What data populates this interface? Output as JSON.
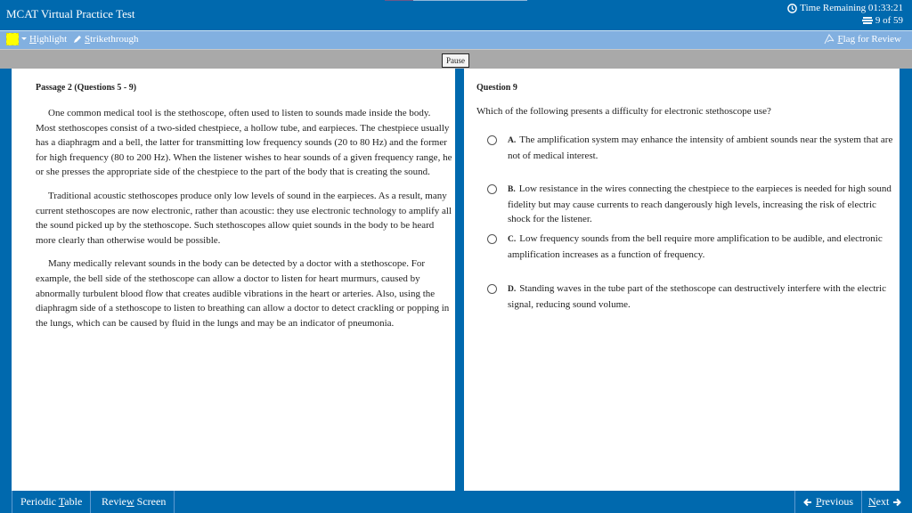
{
  "header": {
    "app_title": "MCAT Virtual Practice Test",
    "timer_label": "Time Remaining 01:33:21",
    "question_counter": "9 of 59"
  },
  "toolbar": {
    "highlight_color": "#ffff00",
    "highlight_label_u": "H",
    "highlight_label_rest": "ighlight",
    "strike_label_u": "S",
    "strike_label_rest": "trikethrough",
    "flag_label_u": "F",
    "flag_label_rest": "lag for Review"
  },
  "pause": {
    "label": "Pause"
  },
  "passage": {
    "title": "Passage 2 (Questions 5 - 9)",
    "paragraphs": [
      "One common medical tool is the stethoscope, often used to listen to sounds made inside the body. Most stethoscopes consist of a two-sided chestpiece, a hollow tube, and earpieces. The chestpiece usually has a diaphragm and a bell, the latter for transmitting low frequency sounds (20 to 80 Hz) and the former for high frequency (80 to 200 Hz). When the listener wishes to hear sounds of a given frequency range, he or she presses the appropriate side of the chestpiece to the part of the body that is creating the sound.",
      "Traditional acoustic stethoscopes produce only low levels of sound in the earpieces. As a result, many current stethoscopes are now electronic, rather than acoustic: they use electronic technology to amplify all the sound picked up by the stethoscope. Such stethoscopes allow quiet sounds in the body to be heard more clearly than otherwise would be possible.",
      "Many medically relevant sounds in the body can be detected by a doctor with a stethoscope. For example, the bell side of the stethoscope can allow a doctor to listen for heart murmurs, caused by abnormally turbulent blood flow that creates audible vibrations in the heart or arteries. Also, using the diaphragm side of a stethoscope to listen to breathing can allow a doctor to detect crackling or popping in the lungs, which can be caused by fluid in the lungs and may be an indicator of pneumonia."
    ]
  },
  "question": {
    "title": "Question 9",
    "stem": "Which of the following presents a difficulty for electronic stethoscope use?",
    "choices": [
      {
        "letter": "A.",
        "text": "The amplification system may enhance the intensity of ambient sounds near the system that are not of medical interest."
      },
      {
        "letter": "B.",
        "text": "Low resistance in the wires connecting the chestpiece to the earpieces is needed for high sound fidelity but may cause currents to reach dangerously high levels, increasing the risk of electric shock for the listener."
      },
      {
        "letter": "C.",
        "text": "Low frequency sounds from the bell require more amplification to be audible, and electronic amplification increases as a function of frequency."
      },
      {
        "letter": "D.",
        "text": "Standing waves in the tube part of the stethoscope can destructively interfere with the electric signal, reducing sound volume."
      }
    ]
  },
  "footer": {
    "periodic_pre": "Periodic ",
    "periodic_u": "T",
    "periodic_post": "able",
    "review_pre": "Revie",
    "review_u": "w",
    "review_post": " Screen",
    "prev_u": "P",
    "prev_rest": "revious",
    "next_u": "N",
    "next_rest": "ext"
  }
}
